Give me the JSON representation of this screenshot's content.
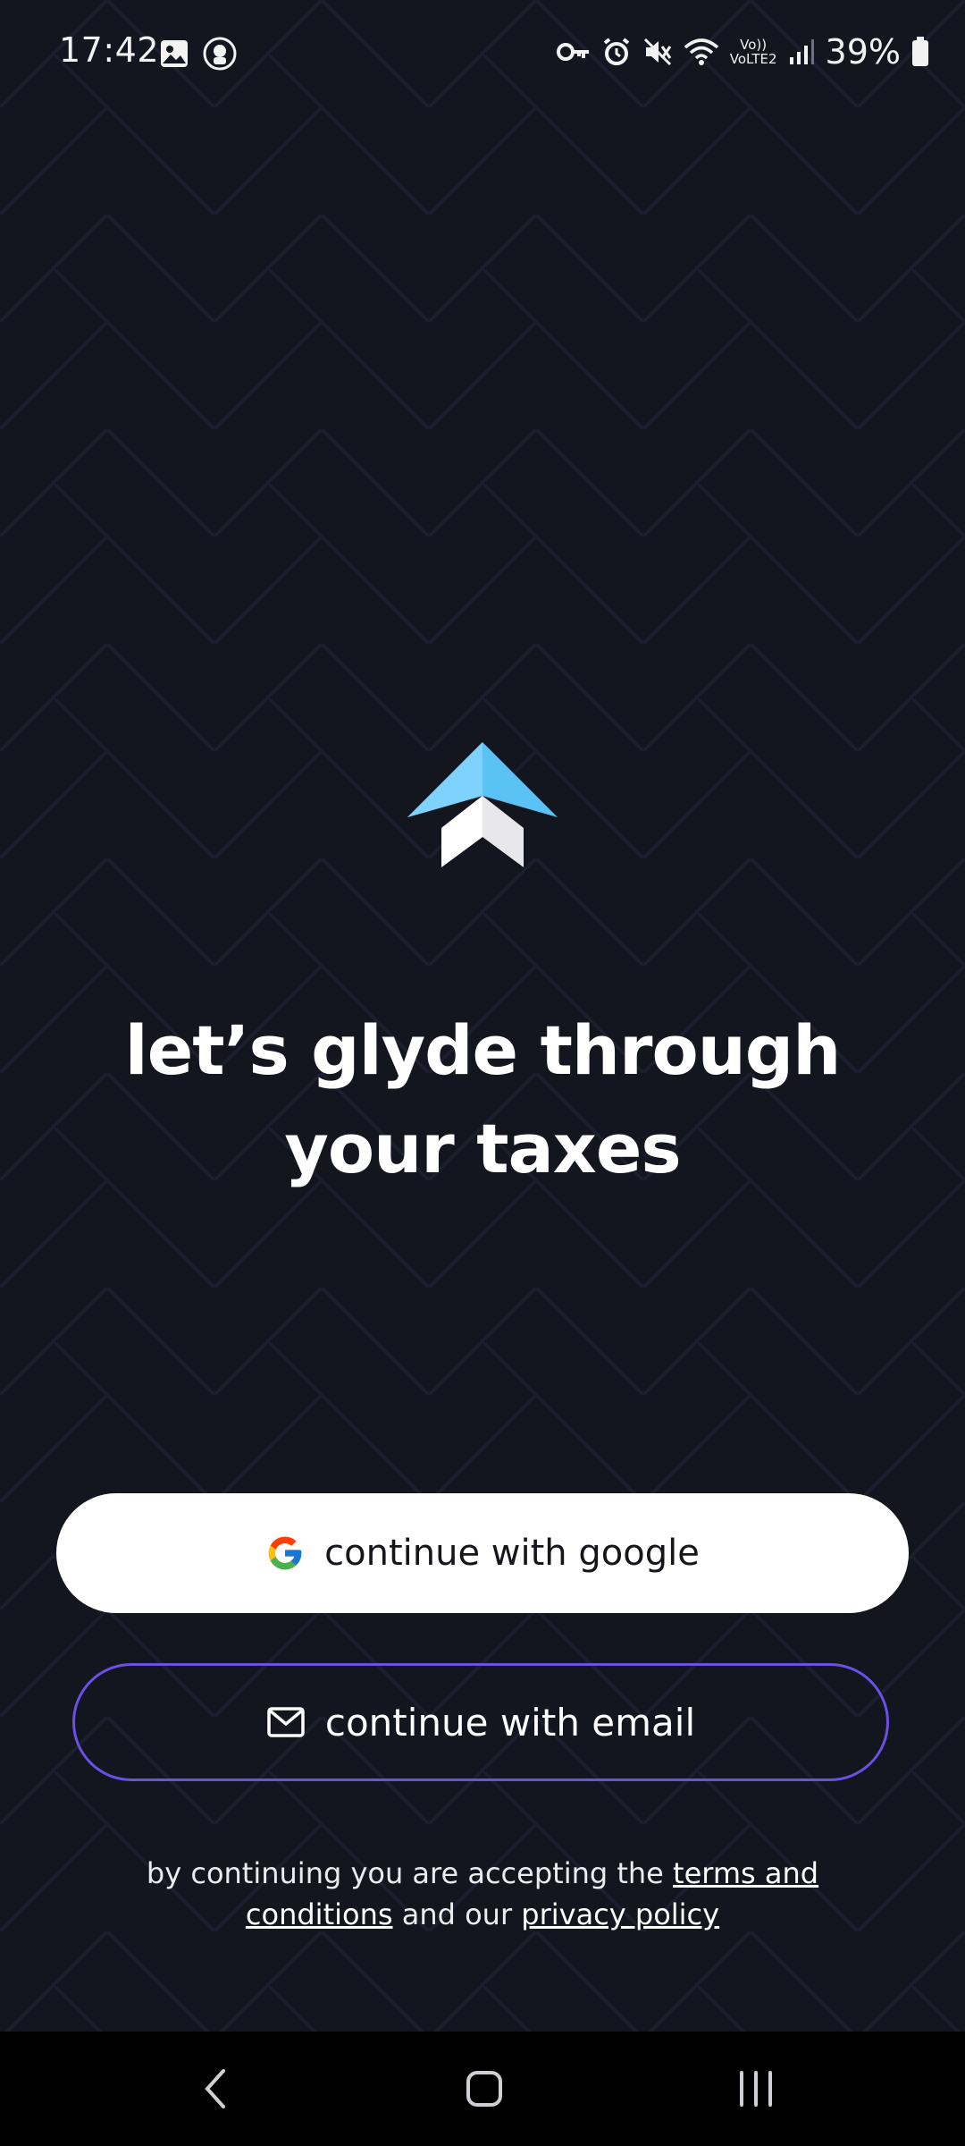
{
  "status_bar": {
    "time": "17:42",
    "battery_percent": "39%",
    "network_label": "VoLTE2",
    "left_icons": [
      "gallery-icon",
      "app-notification-icon"
    ],
    "right_icons": [
      "key-icon",
      "alarm-icon",
      "mute-icon",
      "wifi-icon",
      "volte-icon",
      "signal-icon",
      "battery-icon"
    ]
  },
  "brand": {
    "logo": "glyde-arrow-logo",
    "accent_color": "#5bc2f5",
    "headline_line1": "let’s glyde through",
    "headline_line2": "your taxes"
  },
  "auth": {
    "google_label": "continue with google",
    "email_label": "continue with email",
    "email_border_color": "#6b4fe6"
  },
  "legal": {
    "prefix": "by continuing you are accepting the ",
    "terms_link": "terms and conditions",
    "middle": " and our ",
    "privacy_link": "privacy policy"
  },
  "nav_bar": {
    "buttons": [
      "back-icon",
      "home-icon",
      "recents-icon"
    ]
  }
}
